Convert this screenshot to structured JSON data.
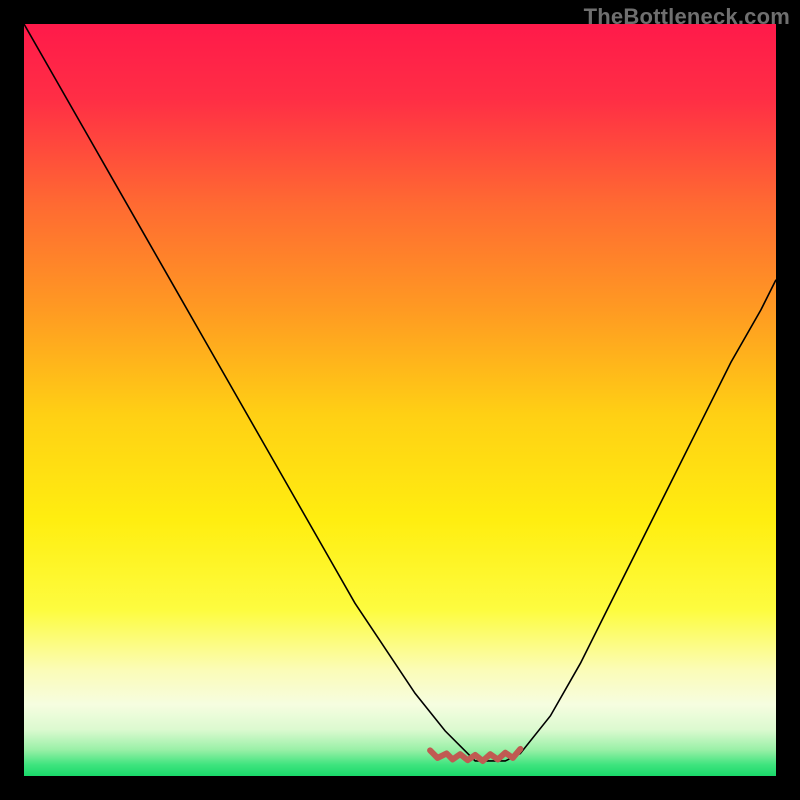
{
  "watermark": "TheBottleneck.com",
  "chart_data": {
    "type": "line",
    "title": "",
    "xlabel": "",
    "ylabel": "",
    "xlim": [
      0,
      100
    ],
    "ylim": [
      0,
      100
    ],
    "grid": false,
    "legend": false,
    "background_gradient": {
      "stops": [
        {
          "offset": 0.0,
          "color": "#ff1a4a"
        },
        {
          "offset": 0.1,
          "color": "#ff2e45"
        },
        {
          "offset": 0.24,
          "color": "#ff6a32"
        },
        {
          "offset": 0.38,
          "color": "#ff9a22"
        },
        {
          "offset": 0.52,
          "color": "#ffd014"
        },
        {
          "offset": 0.66,
          "color": "#ffee10"
        },
        {
          "offset": 0.78,
          "color": "#fdfc40"
        },
        {
          "offset": 0.86,
          "color": "#fbfcb8"
        },
        {
          "offset": 0.905,
          "color": "#f6fde0"
        },
        {
          "offset": 0.938,
          "color": "#dcfad0"
        },
        {
          "offset": 0.965,
          "color": "#9af0a7"
        },
        {
          "offset": 0.985,
          "color": "#3fe47e"
        },
        {
          "offset": 1.0,
          "color": "#19d96a"
        }
      ]
    },
    "series": [
      {
        "name": "bottleneck-curve",
        "color": "#000000",
        "width": 1.6,
        "x": [
          0,
          4,
          8,
          12,
          16,
          20,
          24,
          28,
          32,
          36,
          40,
          44,
          48,
          52,
          56,
          58,
          60,
          62,
          64,
          66,
          70,
          74,
          78,
          82,
          86,
          90,
          94,
          98,
          100
        ],
        "y": [
          100,
          93,
          86,
          79,
          72,
          65,
          58,
          51,
          44,
          37,
          30,
          23,
          17,
          11,
          6,
          4,
          2,
          2,
          2,
          3,
          8,
          15,
          23,
          31,
          39,
          47,
          55,
          62,
          66
        ]
      }
    ],
    "annotations": [
      {
        "name": "bottom-squiggle",
        "color": "#c05a52",
        "width": 6,
        "path_x": [
          54,
          55,
          56.2,
          57,
          58,
          59,
          60,
          61,
          62,
          63,
          64,
          65,
          66
        ],
        "path_y": [
          3.4,
          2.4,
          3.0,
          2.2,
          2.9,
          2.1,
          2.8,
          2.0,
          2.9,
          2.2,
          3.1,
          2.4,
          3.6
        ]
      }
    ]
  }
}
